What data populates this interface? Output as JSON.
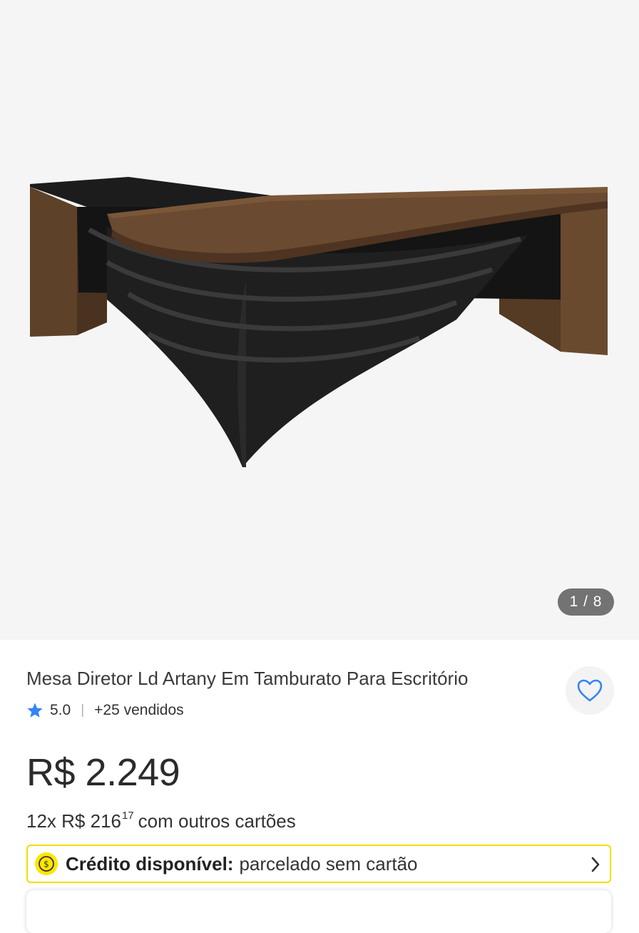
{
  "gallery": {
    "image_alt": "Mesa de escritório em L com tampo amadeirado e estrutura preta",
    "counter": "1 / 8"
  },
  "product": {
    "title": "Mesa Diretor Ld Artany Em Tamburato Para Escritório",
    "rating": "5.0",
    "separator": "|",
    "sold": "+25 vendidos",
    "price": "R$ 2.249",
    "installments_prefix": "12x R$ 216",
    "installments_cents": "17",
    "installments_suffix": "com outros cartões"
  },
  "credit_banner": {
    "label_bold": "Crédito disponível:",
    "label_rest": "parcelado sem cartão"
  },
  "icons": {
    "favorite": "heart-outline-icon",
    "rating": "star-icon",
    "credit": "coin-icon",
    "chevron": "chevron-right-icon"
  },
  "colors": {
    "accent_blue": "#3483fa",
    "credit_border": "#f2de00",
    "coin_yellow": "#ffe600",
    "counter_bg": "#737373"
  }
}
